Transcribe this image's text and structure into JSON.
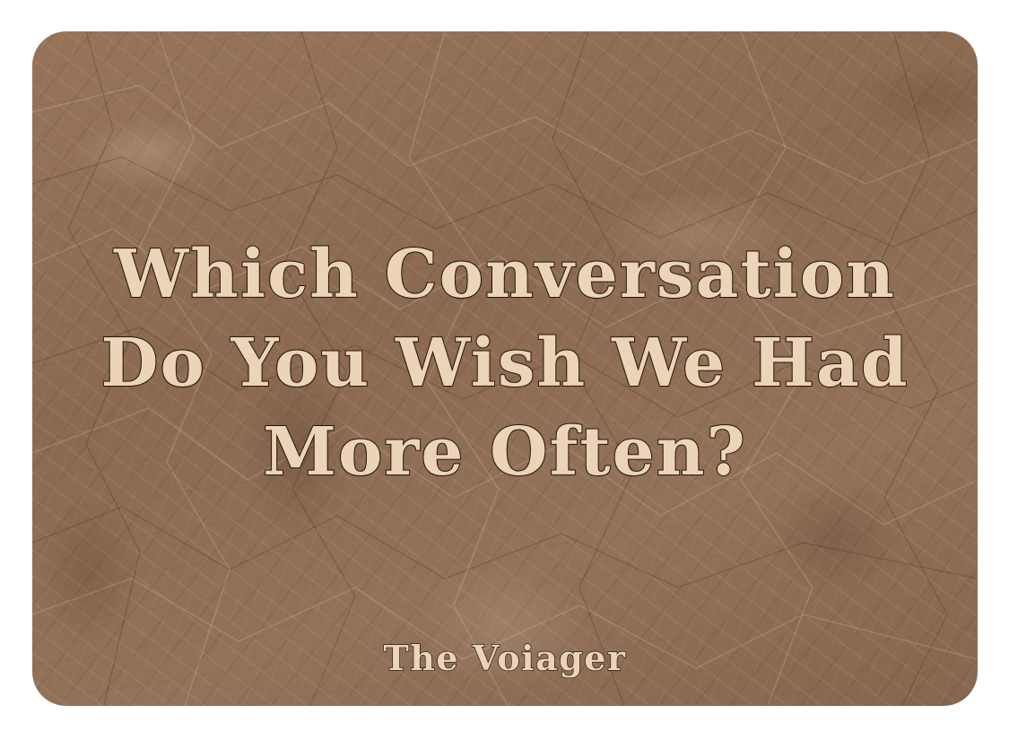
{
  "card": {
    "title_lines": [
      "Which Conversation",
      "Do You Wish We Had",
      "More Often?"
    ],
    "author": "The Voiager"
  },
  "colors": {
    "background": "#ffffff",
    "card": "#8f6e55",
    "text_fill": "#ecd4b8",
    "text_outline": "#2a1a10"
  }
}
